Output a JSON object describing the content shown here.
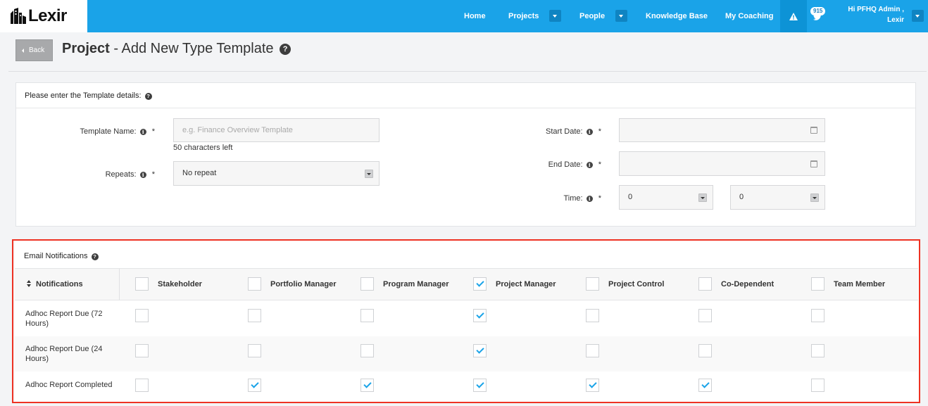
{
  "brand": {
    "name": "Lexir"
  },
  "nav": {
    "items": [
      {
        "label": "Home"
      },
      {
        "label": "Projects"
      },
      {
        "label": "People"
      },
      {
        "label": "Knowledge Base"
      },
      {
        "label": "My Coaching"
      }
    ],
    "badge": "915",
    "user_line1": "Hi PFHQ Admin ,",
    "user_line2": "Lexir"
  },
  "header": {
    "back_label": "Back",
    "title_bold": "Project",
    "title_rest": " - Add New Type Template",
    "help_glyph": "?"
  },
  "details": {
    "heading": "Please enter the Template details:",
    "template_name": {
      "label": "Template Name:",
      "placeholder": "e.g. Finance Overview Template",
      "hint": "50 characters left"
    },
    "repeats": {
      "label": "Repeats:",
      "value": "No repeat"
    },
    "start_date": {
      "label": "Start Date:",
      "value": ""
    },
    "end_date": {
      "label": "End Date:",
      "value": ""
    },
    "time": {
      "label": "Time:",
      "hours": "0",
      "minutes": "0"
    },
    "required": "*",
    "info_glyph": "i"
  },
  "notifications": {
    "heading": "Email Notifications",
    "first_column": "Notifications",
    "columns": [
      {
        "label": "Stakeholder",
        "checked": false
      },
      {
        "label": "Portfolio Manager",
        "checked": false
      },
      {
        "label": "Program Manager",
        "checked": false
      },
      {
        "label": "Project Manager",
        "checked": true
      },
      {
        "label": "Project Control",
        "checked": false
      },
      {
        "label": "Co-Dependent",
        "checked": false
      },
      {
        "label": "Team Member",
        "checked": false
      }
    ],
    "rows": [
      {
        "label": "Adhoc Report Due (72 Hours)",
        "checks": [
          false,
          false,
          false,
          true,
          false,
          false,
          false
        ]
      },
      {
        "label": "Adhoc Report Due (24 Hours)",
        "checks": [
          false,
          false,
          false,
          true,
          false,
          false,
          false
        ]
      },
      {
        "label": "Adhoc Report Completed",
        "checks": [
          false,
          true,
          true,
          true,
          true,
          true,
          false
        ]
      }
    ]
  },
  "colors": {
    "nav_bg": "#1aa3e8",
    "check": "#1aa3e8",
    "highlight": "#ee3223"
  }
}
